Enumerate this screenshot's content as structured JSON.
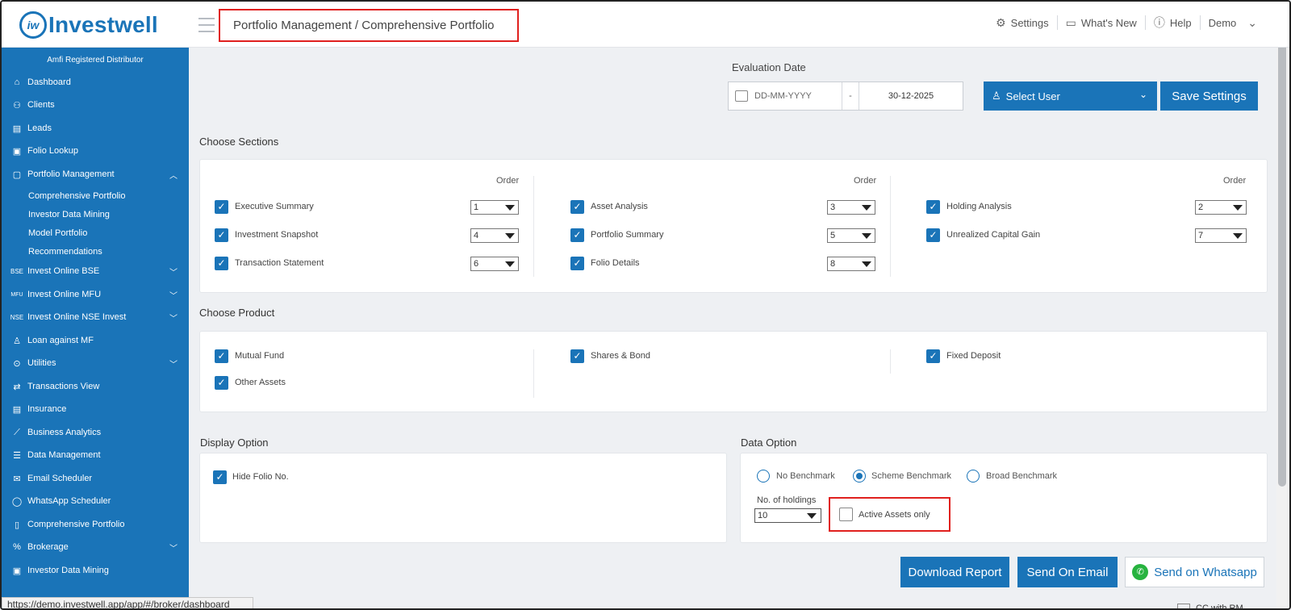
{
  "brand": {
    "logo_mark": "iw",
    "logo_text": "Investwell"
  },
  "header": {
    "breadcrumb": "Portfolio Management / Comprehensive Portfolio",
    "nav": [
      {
        "label": "Settings",
        "icon": "gear-icon"
      },
      {
        "label": "What's New",
        "icon": "chat-icon"
      },
      {
        "label": "Help",
        "icon": "info-icon"
      },
      {
        "label": "Demo",
        "icon": "chevron-down-icon"
      }
    ]
  },
  "sidebar": {
    "header": "Amfi Registered Distributor",
    "items": [
      {
        "label": "Dashboard",
        "icon": "home-icon",
        "chevron": ""
      },
      {
        "label": "Clients",
        "icon": "users-icon",
        "chevron": ""
      },
      {
        "label": "Leads",
        "icon": "leads-icon",
        "chevron": ""
      },
      {
        "label": "Folio Lookup",
        "icon": "folio-lookup-icon",
        "chevron": ""
      },
      {
        "label": "Portfolio Management",
        "icon": "briefcase-icon",
        "chevron": "^"
      },
      {
        "label": "Invest Online BSE",
        "icon": "bse-icon",
        "chevron": "v"
      },
      {
        "label": "Invest Online MFU",
        "icon": "mfu-icon",
        "chevron": "v"
      },
      {
        "label": "Invest Online NSE Invest",
        "icon": "nse-icon",
        "chevron": "v"
      },
      {
        "label": "Loan against MF",
        "icon": "loan-icon",
        "chevron": ""
      },
      {
        "label": "Utilities",
        "icon": "utilities-icon",
        "chevron": "v"
      },
      {
        "label": "Transactions View",
        "icon": "transfer-icon",
        "chevron": ""
      },
      {
        "label": "Insurance",
        "icon": "insurance-icon",
        "chevron": ""
      },
      {
        "label": "Business Analytics",
        "icon": "analytics-icon",
        "chevron": ""
      },
      {
        "label": "Data Management",
        "icon": "database-icon",
        "chevron": ""
      },
      {
        "label": "Email Scheduler",
        "icon": "email-icon",
        "chevron": ""
      },
      {
        "label": "WhatsApp Scheduler",
        "icon": "whatsapp-icon",
        "chevron": ""
      },
      {
        "label": "Comprehensive Portfolio",
        "icon": "portfolio-icon",
        "chevron": ""
      },
      {
        "label": "Brokerage",
        "icon": "brokerage-icon",
        "chevron": "v"
      },
      {
        "label": "Investor Data Mining",
        "icon": "mining-icon",
        "chevron": ""
      }
    ],
    "sub_items": [
      "Comprehensive Portfolio",
      "Investor Data Mining",
      "Model Portfolio",
      "Recommendations"
    ],
    "status_url": "https://demo.investwell.app/app/#/broker/dashboard"
  },
  "controls": {
    "evaluation_label": "Evaluation Date",
    "date_from_placeholder": "DD-MM-YYYY",
    "date_separator": "-",
    "date_to": "30-12-2025",
    "select_user": "Select User",
    "save_settings": "Save Settings"
  },
  "sections": {
    "title": "Choose Sections",
    "order_label": "Order",
    "items": [
      {
        "label": "Executive Summary",
        "order": "1",
        "checked": true
      },
      {
        "label": "Investment Snapshot",
        "order": "4",
        "checked": true
      },
      {
        "label": "Transaction Statement",
        "order": "6",
        "checked": true
      },
      {
        "label": "Asset Analysis",
        "order": "3",
        "checked": true
      },
      {
        "label": "Portfolio Summary",
        "order": "5",
        "checked": true
      },
      {
        "label": "Folio Details",
        "order": "8",
        "checked": true
      },
      {
        "label": "Holding Analysis",
        "order": "2",
        "checked": true
      },
      {
        "label": "Unrealized Capital Gain",
        "order": "7",
        "checked": true
      }
    ]
  },
  "products": {
    "title": "Choose Product",
    "items": [
      {
        "label": "Mutual Fund",
        "checked": true
      },
      {
        "label": "Other Assets",
        "checked": true
      },
      {
        "label": "Shares & Bond",
        "checked": true
      },
      {
        "label": "Fixed Deposit",
        "checked": true
      }
    ]
  },
  "display_option": {
    "title": "Display Option",
    "hide_folio": "Hide Folio No.",
    "hide_folio_checked": true
  },
  "data_option": {
    "title": "Data Option",
    "radios": [
      {
        "label": "No Benchmark",
        "selected": false
      },
      {
        "label": "Scheme Benchmark",
        "selected": true
      },
      {
        "label": "Broad Benchmark",
        "selected": false
      }
    ],
    "holdings_label": "No. of holdings",
    "holdings_value": "10",
    "active_assets": "Active Assets only",
    "active_assets_checked": false
  },
  "actions": {
    "download": "Download Report",
    "email": "Send On Email",
    "whatsapp": "Send on Whatsapp"
  },
  "footer": {
    "partial_text": "CC with RM"
  },
  "colors": {
    "brand": "#1a74b8",
    "highlight": "#e0201e",
    "whatsapp": "#27b33f"
  }
}
